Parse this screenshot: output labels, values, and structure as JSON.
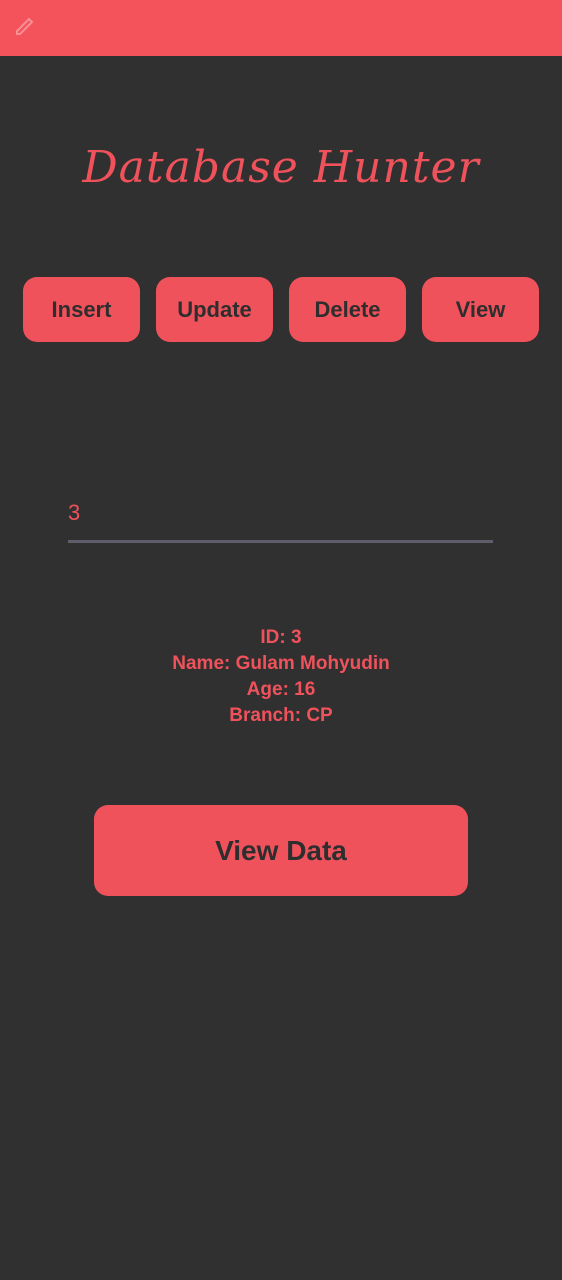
{
  "header": {
    "title": "Database Hunter"
  },
  "nav": {
    "insert_label": "Insert",
    "update_label": "Update",
    "delete_label": "Delete",
    "view_label": "View"
  },
  "form": {
    "id_value": "3"
  },
  "result": {
    "id_line": "ID: 3",
    "name_line": "Name: Gulam Mohyudin",
    "age_line": "Age: 16",
    "branch_line": "Branch: CP"
  },
  "actions": {
    "view_data_label": "View Data"
  },
  "colors": {
    "accent": "#f0525c",
    "status_bar": "#f4535c",
    "background": "#303030",
    "button_text": "#2e2e2e",
    "input_underline": "#5e5e6a"
  },
  "icons": {
    "status_bar_glyph": "edit-pencil-icon"
  }
}
